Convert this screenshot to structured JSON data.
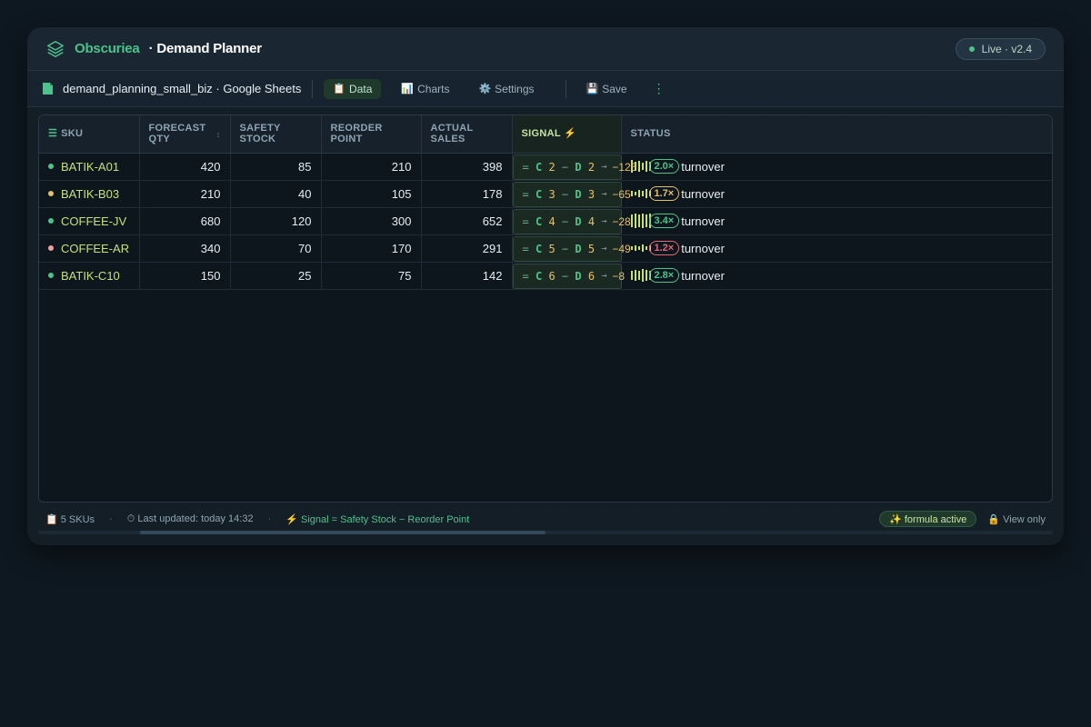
{
  "app": {
    "brand": "Obscuriea",
    "title": "· Demand Planner",
    "live_badge": "Live · v2.4"
  },
  "toolbar": {
    "filename": "demand_planning_small_biz · Google Sheets",
    "buttons": [
      {
        "icon": "📋",
        "label": "Data",
        "active": true
      },
      {
        "icon": "📊",
        "label": "Charts",
        "active": false
      },
      {
        "icon": "⚙️",
        "label": "Settings",
        "active": false
      },
      {
        "icon": "💾",
        "label": "Save",
        "active": false
      }
    ],
    "more": "⋮"
  },
  "table": {
    "headers": {
      "sku": "SKU",
      "forecast_qty": "FORECAST QTY",
      "safety_stock": "SAFETY STOCK",
      "reorder_point": "REORDER POINT",
      "actual_sales": "ACTUAL SALES",
      "signal": "SIGNAL ⚡",
      "status": "STATUS"
    },
    "rows": [
      {
        "sku": "BATIK-A01",
        "dot": "#4cc38a",
        "forecast": "420",
        "safety": "85",
        "reorder": "210",
        "actual": "398",
        "sig_c": "C",
        "sig_cn": "2",
        "sig_d": "D",
        "sig_dn": "2",
        "sig_res": "−125",
        "spark": [
          14,
          10,
          12,
          8,
          12,
          10
        ],
        "ratio": "2.0×",
        "ratio_color": "#4cc38a",
        "status": "turnover"
      },
      {
        "sku": "BATIK-B03",
        "dot": "#e3c06a",
        "forecast": "210",
        "safety": "40",
        "reorder": "105",
        "actual": "178",
        "sig_c": "C",
        "sig_cn": "3",
        "sig_d": "D",
        "sig_dn": "3",
        "sig_res": "−65",
        "spark": [
          6,
          4,
          8,
          6,
          10,
          6
        ],
        "ratio": "1.7×",
        "ratio_color": "#e3c06a",
        "status": "turnover"
      },
      {
        "sku": "COFFEE-JV",
        "dot": "#4cc38a",
        "forecast": "680",
        "safety": "120",
        "reorder": "300",
        "actual": "652",
        "sig_c": "C",
        "sig_cn": "4",
        "sig_d": "D",
        "sig_dn": "4",
        "sig_res": "−28",
        "spark": [
          14,
          16,
          14,
          16,
          14,
          16
        ],
        "ratio": "3.4×",
        "ratio_color": "#4cc38a",
        "status": "turnover"
      },
      {
        "sku": "COFFEE-AR",
        "dot": "#f0a0a8",
        "forecast": "340",
        "safety": "70",
        "reorder": "170",
        "actual": "291",
        "sig_c": "C",
        "sig_cn": "5",
        "sig_d": "D",
        "sig_dn": "5",
        "sig_res": "−49",
        "spark": [
          4,
          6,
          4,
          8,
          4,
          6
        ],
        "ratio": "1.2×",
        "ratio_color": "#e06a78",
        "status": "turnover"
      },
      {
        "sku": "BATIK-C10",
        "dot": "#4cc38a",
        "forecast": "150",
        "safety": "25",
        "reorder": "75",
        "actual": "142",
        "sig_c": "C",
        "sig_cn": "6",
        "sig_d": "D",
        "sig_dn": "6",
        "sig_res": "−8",
        "spark": [
          10,
          12,
          10,
          14,
          12,
          10
        ],
        "ratio": "2.8×",
        "ratio_color": "#4cc38a",
        "status": "turnover"
      }
    ],
    "sig_eq": "=",
    "sig_minus": "−",
    "sig_arrow": "→"
  },
  "statusbar": {
    "skus": "📋 5 SKUs",
    "sep": "·",
    "updated": "⏱ Last updated: today 14:32",
    "formula": "⚡ Signal = Safety Stock − Reorder Point",
    "formula_badge": "✨ formula active",
    "view_only": "🔒 View only"
  },
  "icons": {
    "logo": "layers-logo-icon",
    "doc": "sheet-doc-icon",
    "sku_header": "rows-icon",
    "sort": "sort-icon"
  },
  "colors": {
    "accent": "#4cc38a",
    "warning": "#e3c06a",
    "danger": "#e06a78"
  }
}
